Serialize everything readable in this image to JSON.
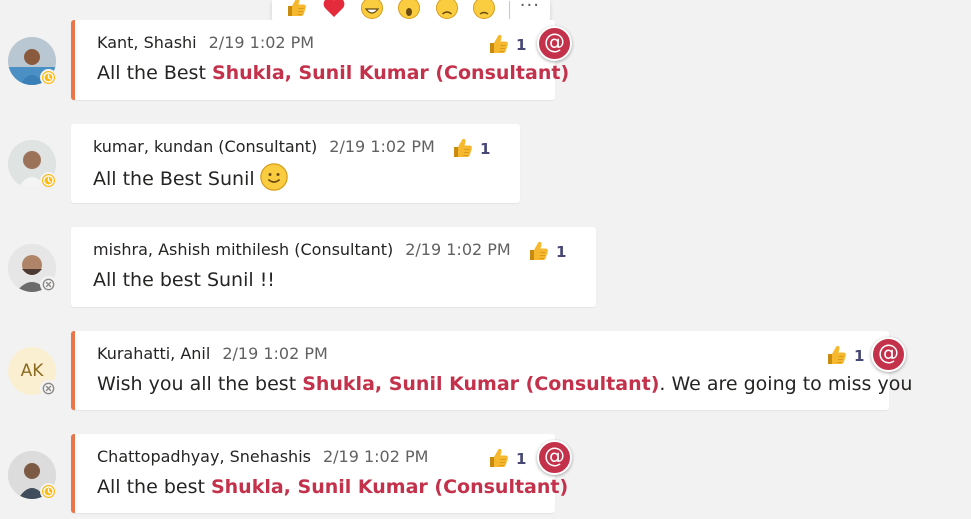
{
  "reaction_bar": {
    "reactions": [
      "like",
      "heart",
      "laugh",
      "surprised",
      "sad",
      "angry"
    ],
    "more_label": "···"
  },
  "colors": {
    "mention_accent": "#e97548",
    "mention_name": "#c4314b",
    "at_badge": "#c4314b",
    "away": "#fdb913",
    "reaction_count": "#464775"
  },
  "messages": [
    {
      "author": "Kant, Shashi",
      "time": "2/19 1:02 PM",
      "text_before": "All the Best ",
      "mention": "Shukla, Sunil Kumar (Consultant)",
      "text_after": "",
      "reaction_count": "1",
      "at_badge": "@",
      "presence": "away"
    },
    {
      "author": "kumar, kundan (Consultant)",
      "time": "2/19 1:02 PM",
      "text": "All the Best Sunil",
      "reaction_count": "1",
      "presence": "away"
    },
    {
      "author": "mishra, Ashish mithilesh (Consultant)",
      "time": "2/19 1:02 PM",
      "text": "All the best Sunil !!",
      "reaction_count": "1",
      "presence": "offline"
    },
    {
      "author": "Kurahatti, Anil",
      "initials": "AK",
      "time": "2/19 1:02 PM",
      "text_before": "Wish you all the best ",
      "mention": "Shukla, Sunil Kumar (Consultant)",
      "text_after": ". We are going to miss you",
      "reaction_count": "1",
      "at_badge": "@",
      "presence": "offline"
    },
    {
      "author": "Chattopadhyay, Snehashis",
      "time": "2/19 1:02 PM",
      "text_before": "All the best ",
      "mention": "Shukla, Sunil Kumar (Consultant)",
      "text_after": "",
      "reaction_count": "1",
      "at_badge": "@",
      "presence": "away"
    }
  ]
}
